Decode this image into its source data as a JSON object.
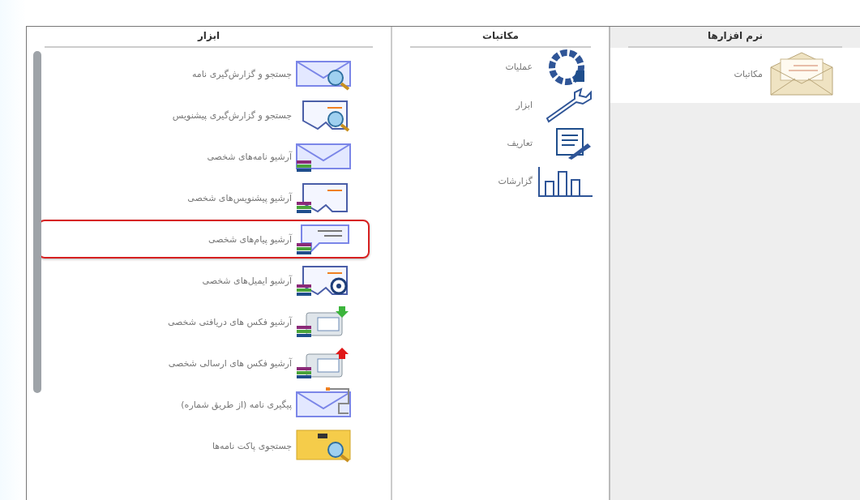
{
  "software": {
    "title": "نرم افزارها",
    "items": [
      {
        "label": "مکاتبات",
        "selected": true
      }
    ]
  },
  "categories": {
    "title": "مکاتبات",
    "items": [
      {
        "label": "عملیات"
      },
      {
        "label": "ابزار"
      },
      {
        "label": "تعاریف"
      },
      {
        "label": "گزارشات"
      }
    ]
  },
  "tools": {
    "title": "ابزار",
    "items": [
      {
        "label": "جستجو و گزارش‌گیری نامه",
        "highlighted": false
      },
      {
        "label": "جستجو و گزارش‌گیری پیشنویس",
        "highlighted": false
      },
      {
        "label": "آرشیو نامه‌های شخصی",
        "highlighted": false
      },
      {
        "label": "آرشیو پیشنویس‌های شخصی",
        "highlighted": false
      },
      {
        "label": "آرشیو پیام‌های شخصی",
        "highlighted": true
      },
      {
        "label": "آرشیو ایمیل‌های شخصی",
        "highlighted": false
      },
      {
        "label": "آرشیو فکس های دریافتی شخصی",
        "highlighted": false
      },
      {
        "label": "آرشیو فکس های ارسالی شخصی",
        "highlighted": false
      },
      {
        "label": "پیگیری نامه (از طریق شماره)",
        "highlighted": false
      },
      {
        "label": "جستجوی پاکت نامه‌ها",
        "highlighted": false
      }
    ]
  }
}
